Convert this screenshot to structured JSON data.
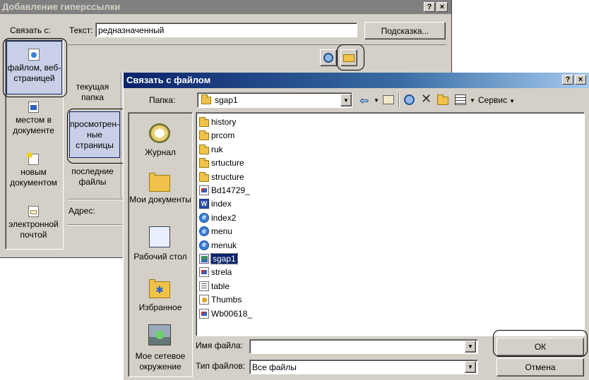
{
  "outer": {
    "title": "Добавление гиперссылки",
    "help_btn": "?",
    "close_btn": "×",
    "link_label": "Связать с:",
    "text_label": "Текст:",
    "text_value": "редназначенный",
    "hint_btn": "Подсказка...",
    "nav": [
      {
        "label": "файлом, веб-страницей"
      },
      {
        "label": "местом в документе"
      },
      {
        "label": "новым документом"
      },
      {
        "label": "электронной почтой"
      }
    ],
    "tabs": [
      {
        "label": "текущая папка"
      },
      {
        "label": "просмотрен-ные страницы"
      },
      {
        "label": "последние файлы"
      }
    ],
    "address_label": "Адрес:"
  },
  "inner": {
    "title": "Связать с файлом",
    "help_btn": "?",
    "close_btn": "×",
    "folder_label": "Папка:",
    "folder_value": "sgap1",
    "tools_label": "Сервис",
    "places": [
      {
        "label": "Журнал"
      },
      {
        "label": "Мои документы"
      },
      {
        "label": "Рабочий стол"
      },
      {
        "label": "Избранное"
      },
      {
        "label": "Мое сетевое окружение"
      }
    ],
    "files": [
      {
        "name": "history",
        "icon": "folder"
      },
      {
        "name": "prcom",
        "icon": "folder"
      },
      {
        "name": "ruk",
        "icon": "folder"
      },
      {
        "name": "srtucture",
        "icon": "folder"
      },
      {
        "name": "structure",
        "icon": "folder"
      },
      {
        "name": "Bd14729_",
        "icon": "doc"
      },
      {
        "name": "index",
        "icon": "word"
      },
      {
        "name": "index2",
        "icon": "ie"
      },
      {
        "name": "menu",
        "icon": "ie"
      },
      {
        "name": "menuk",
        "icon": "ie"
      },
      {
        "name": "sgap1",
        "icon": "img",
        "selected": true
      },
      {
        "name": "strela",
        "icon": "doc"
      },
      {
        "name": "table",
        "icon": "table"
      },
      {
        "name": "Thumbs",
        "icon": "thumb"
      },
      {
        "name": "Wb00618_",
        "icon": "doc"
      }
    ],
    "filename_label": "Имя файла:",
    "filename_value": "",
    "filetype_label": "Тип файлов:",
    "filetype_value": "Все файлы",
    "ok_btn": "ОК",
    "cancel_btn": "Отмена"
  }
}
